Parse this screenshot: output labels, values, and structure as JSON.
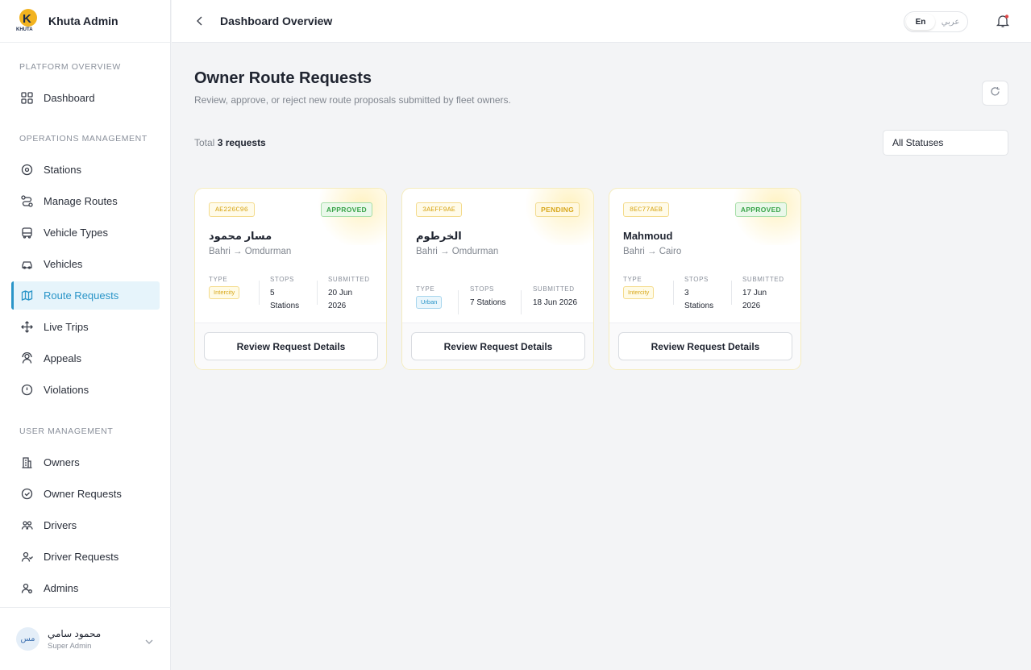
{
  "brand": {
    "name": "Khuta Admin",
    "logo_text": "KHUTA"
  },
  "sidebar": {
    "sections": [
      {
        "title": "PLATFORM OVERVIEW"
      },
      {
        "title": "OPERATIONS MANAGEMENT"
      },
      {
        "title": "USER MANAGEMENT"
      }
    ],
    "items": [
      {
        "label": "Dashboard",
        "icon": "grid-icon"
      },
      {
        "label": "Stations",
        "icon": "map-pin-icon"
      },
      {
        "label": "Manage Routes",
        "icon": "route-icon"
      },
      {
        "label": "Vehicle Types",
        "icon": "bus-icon"
      },
      {
        "label": "Vehicles",
        "icon": "car-icon"
      },
      {
        "label": "Route Requests",
        "icon": "map-icon",
        "active": true
      },
      {
        "label": "Live Trips",
        "icon": "move-icon"
      },
      {
        "label": "Appeals",
        "icon": "users-icon"
      },
      {
        "label": "Violations",
        "icon": "alert-circle-icon"
      },
      {
        "label": "Owners",
        "icon": "building-icon"
      },
      {
        "label": "Owner Requests",
        "icon": "check-circle-icon"
      },
      {
        "label": "Drivers",
        "icon": "users-icon"
      },
      {
        "label": "Driver Requests",
        "icon": "user-check-icon"
      },
      {
        "label": "Admins",
        "icon": "user-cog-icon"
      }
    ]
  },
  "user": {
    "initials": "مس",
    "name": "محمود سامي",
    "role": "Super Admin"
  },
  "topbar": {
    "title": "Dashboard Overview",
    "lang_en": "En",
    "lang_ar": "عربي"
  },
  "main": {
    "title": "Owner Route Requests",
    "subtitle": "Review, approve, or reject new route proposals submitted by fleet owners.",
    "total_prefix": "Total",
    "total_value": "3 requests",
    "filter": "All Statuses"
  },
  "labels": {
    "type": "TYPE",
    "stops": "STOPS",
    "submitted": "SUBMITTED",
    "review": "Review Request Details"
  },
  "cards": [
    {
      "code": "AE226C96",
      "status": "APPROVED",
      "name": "مسار محمود",
      "path": "Bahri → Omdurman",
      "type": "Intercity",
      "stops_line1": "5",
      "stops_line2": "Stations",
      "date_line1": "20 Jun",
      "date_line2": "2026"
    },
    {
      "code": "3AEFF9AE",
      "status": "PENDING",
      "name": "الخرطوم",
      "path": "Bahri → Omdurman",
      "type": "Urban",
      "stops_line1": "7 Stations",
      "stops_line2": "",
      "date_line1": "18 Jun 2026",
      "date_line2": ""
    },
    {
      "code": "8EC77AEB",
      "status": "APPROVED",
      "name": "Mahmoud",
      "path": "Bahri → Cairo",
      "type": "Intercity",
      "stops_line1": "3",
      "stops_line2": "Stations",
      "date_line1": "17 Jun",
      "date_line2": "2026"
    }
  ],
  "colors": {
    "accent": "#2a95c8",
    "approved": "#3aa44a",
    "pending": "#d8a71a"
  }
}
